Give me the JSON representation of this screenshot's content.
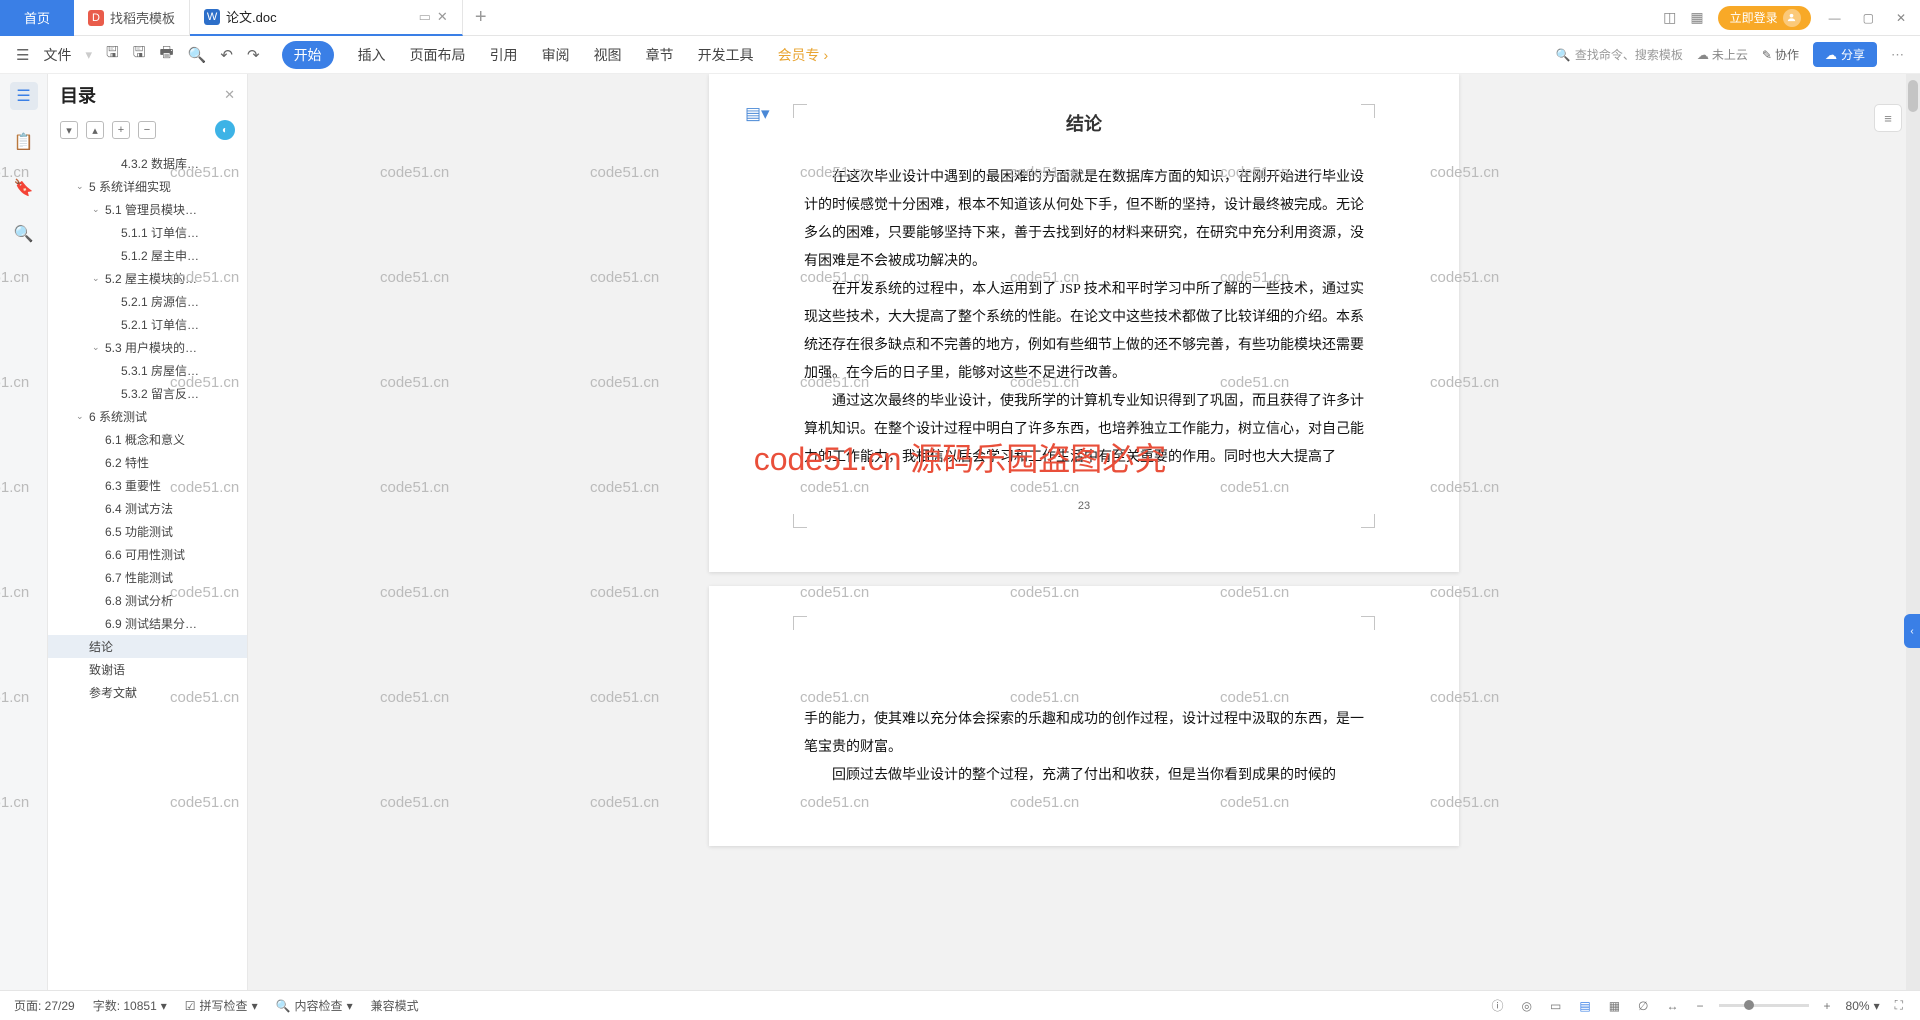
{
  "tabs": {
    "home": "首页",
    "t1": "找稻壳模板",
    "t2": "论文.doc"
  },
  "titlebar": {
    "login": "立即登录"
  },
  "ribbon": {
    "file": "文件",
    "start": "开始",
    "insert": "插入",
    "layout": "页面布局",
    "ref": "引用",
    "review": "审阅",
    "view": "视图",
    "chapter": "章节",
    "dev": "开发工具",
    "member": "会员专",
    "search": "查找命令、搜索模板",
    "cloud": "未上云",
    "collab": "协作",
    "share": "分享"
  },
  "outline": {
    "title": "目录",
    "items": [
      {
        "l": 3,
        "t": "4.3.2 数据库…",
        "a": ""
      },
      {
        "l": 1,
        "t": "5 系统详细实现",
        "a": "v"
      },
      {
        "l": 2,
        "t": "5.1 管理员模块…",
        "a": "v"
      },
      {
        "l": 3,
        "t": "5.1.1 订单信…",
        "a": ""
      },
      {
        "l": 3,
        "t": "5.1.2 屋主申…",
        "a": ""
      },
      {
        "l": 2,
        "t": "5.2 屋主模块的…",
        "a": "v"
      },
      {
        "l": 3,
        "t": "5.2.1 房源信…",
        "a": ""
      },
      {
        "l": 3,
        "t": "5.2.1 订单信…",
        "a": ""
      },
      {
        "l": 2,
        "t": "5.3 用户模块的…",
        "a": "v"
      },
      {
        "l": 3,
        "t": "5.3.1 房屋信…",
        "a": ""
      },
      {
        "l": 3,
        "t": "5.3.2 留言反…",
        "a": ""
      },
      {
        "l": 1,
        "t": "6 系统测试",
        "a": "v"
      },
      {
        "l": 2,
        "t": "6.1 概念和意义",
        "a": ""
      },
      {
        "l": 2,
        "t": "6.2 特性",
        "a": ""
      },
      {
        "l": 2,
        "t": "6.3 重要性",
        "a": ""
      },
      {
        "l": 2,
        "t": "6.4 测试方法",
        "a": ""
      },
      {
        "l": 2,
        "t": "6.5 功能测试",
        "a": ""
      },
      {
        "l": 2,
        "t": "6.6 可用性测试",
        "a": ""
      },
      {
        "l": 2,
        "t": "6.7 性能测试",
        "a": ""
      },
      {
        "l": 2,
        "t": "6.8 测试分析",
        "a": ""
      },
      {
        "l": 2,
        "t": "6.9 测试结果分…",
        "a": ""
      },
      {
        "l": 1,
        "t": "结论",
        "a": "",
        "sel": true
      },
      {
        "l": 1,
        "t": "致谢语",
        "a": ""
      },
      {
        "l": 1,
        "t": "参考文献",
        "a": ""
      }
    ]
  },
  "doc": {
    "heading": "结论",
    "p1": "在这次毕业设计中遇到的最困难的方面就是在数据库方面的知识，在刚开始进行毕业设计的时候感觉十分困难，根本不知道该从何处下手，但不断的坚持，设计最终被完成。无论多么的困难，只要能够坚持下来，善于去找到好的材料来研究，在研究中充分利用资源，没有困难是不会被成功解决的。",
    "p2": "在开发系统的过程中，本人运用到了 JSP 技术和平时学习中所了解的一些技术，通过实现这些技术，大大提高了整个系统的性能。在论文中这些技术都做了比较详细的介绍。本系统还存在很多缺点和不完善的地方，例如有些细节上做的还不够完善，有些功能模块还需要加强。在今后的日子里，能够对这些不足进行改善。",
    "p3": "通过这次最终的毕业设计，使我所学的计算机专业知识得到了巩固，而且获得了许多计算机知识。在整个设计过程中明白了许多东西，也培养独立工作能力，树立信心，对自己能力的工作能力，我相信以后会学习和工作生活中有至关重要的作用。同时也大大提高了",
    "pagenum": "23",
    "p4": "手的能力，使其难以充分体会探索的乐趣和成功的创作过程，设计过程中汲取的东西，是一笔宝贵的财富。",
    "p5": "回顾过去做毕业设计的整个过程，充满了付出和收获，但是当你看到成果的时候的"
  },
  "watermark": {
    "text": "code51.cn",
    "red": "code51.cn 源码乐园盗图必究"
  },
  "status": {
    "page": "页面: 27/29",
    "words": "字数: 10851",
    "spell": "拼写检查",
    "content": "内容检查",
    "compat": "兼容模式",
    "zoom": "80%"
  }
}
